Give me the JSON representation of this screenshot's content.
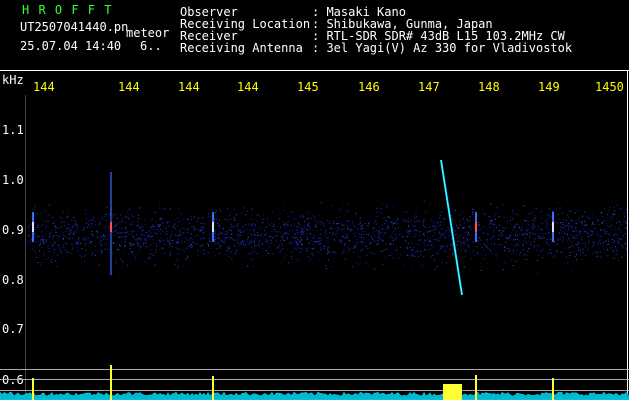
{
  "app": {
    "name": "H R O F F T",
    "filename": "UT2507041440.pn",
    "mode": "meteor",
    "datetime": "25.07.04 14:40",
    "count": "6.."
  },
  "info": {
    "observer_label": "Observer",
    "observer_value": ": Masaki Kano",
    "location_label": "Receiving Location",
    "location_value": ": Shibukawa, Gunma, Japan",
    "receiver_label": "Receiver",
    "receiver_value": ": RTL-SDR SDR# 43dB L15 103.2MHz CW",
    "antenna_label": "Receiving Antenna",
    "antenna_value": ": 3el Yagi(V) Az 330 for Vladivostok"
  },
  "axes": {
    "y_unit": "kHz",
    "y_ticks": [
      "1.1",
      "1.0",
      "0.9",
      "0.8",
      "0.7",
      "0.6"
    ],
    "x_ticks": [
      "144",
      "144",
      "144",
      "144",
      "145",
      "146",
      "147",
      "148",
      "149",
      "1450"
    ]
  },
  "colors": {
    "background": "#000000",
    "title_green": "#33ff33",
    "tick_yellow": "#ffff00",
    "grid": "#aaaaaa",
    "noise_blue": "#1a1aa0",
    "trace_cyan": "#00e5ff",
    "spike_yellow": "#ffff33"
  }
}
